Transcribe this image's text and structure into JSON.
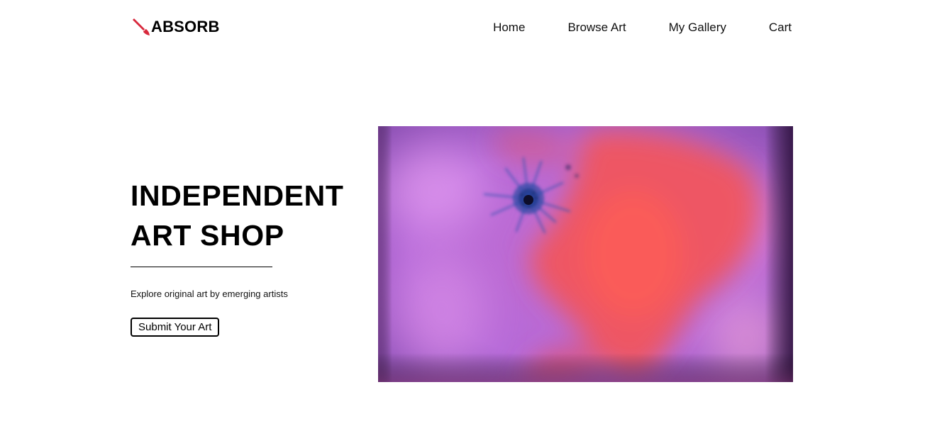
{
  "brand": {
    "name": "ABSORB",
    "icon": "paintbrush-icon",
    "icon_color": "#d8283c"
  },
  "nav": {
    "items": [
      {
        "label": "Home"
      },
      {
        "label": "Browse Art"
      },
      {
        "label": "My Gallery"
      },
      {
        "label": "Cart"
      }
    ]
  },
  "hero": {
    "title_line1": "INDEPENDENT",
    "title_line2": "ART SHOP",
    "subtitle": "Explore original art by emerging artists",
    "cta_label": "Submit Your Art",
    "artwork": {
      "description_colors": [
        "#b46ad8",
        "#f05a5e",
        "#1f3c8a"
      ]
    }
  }
}
